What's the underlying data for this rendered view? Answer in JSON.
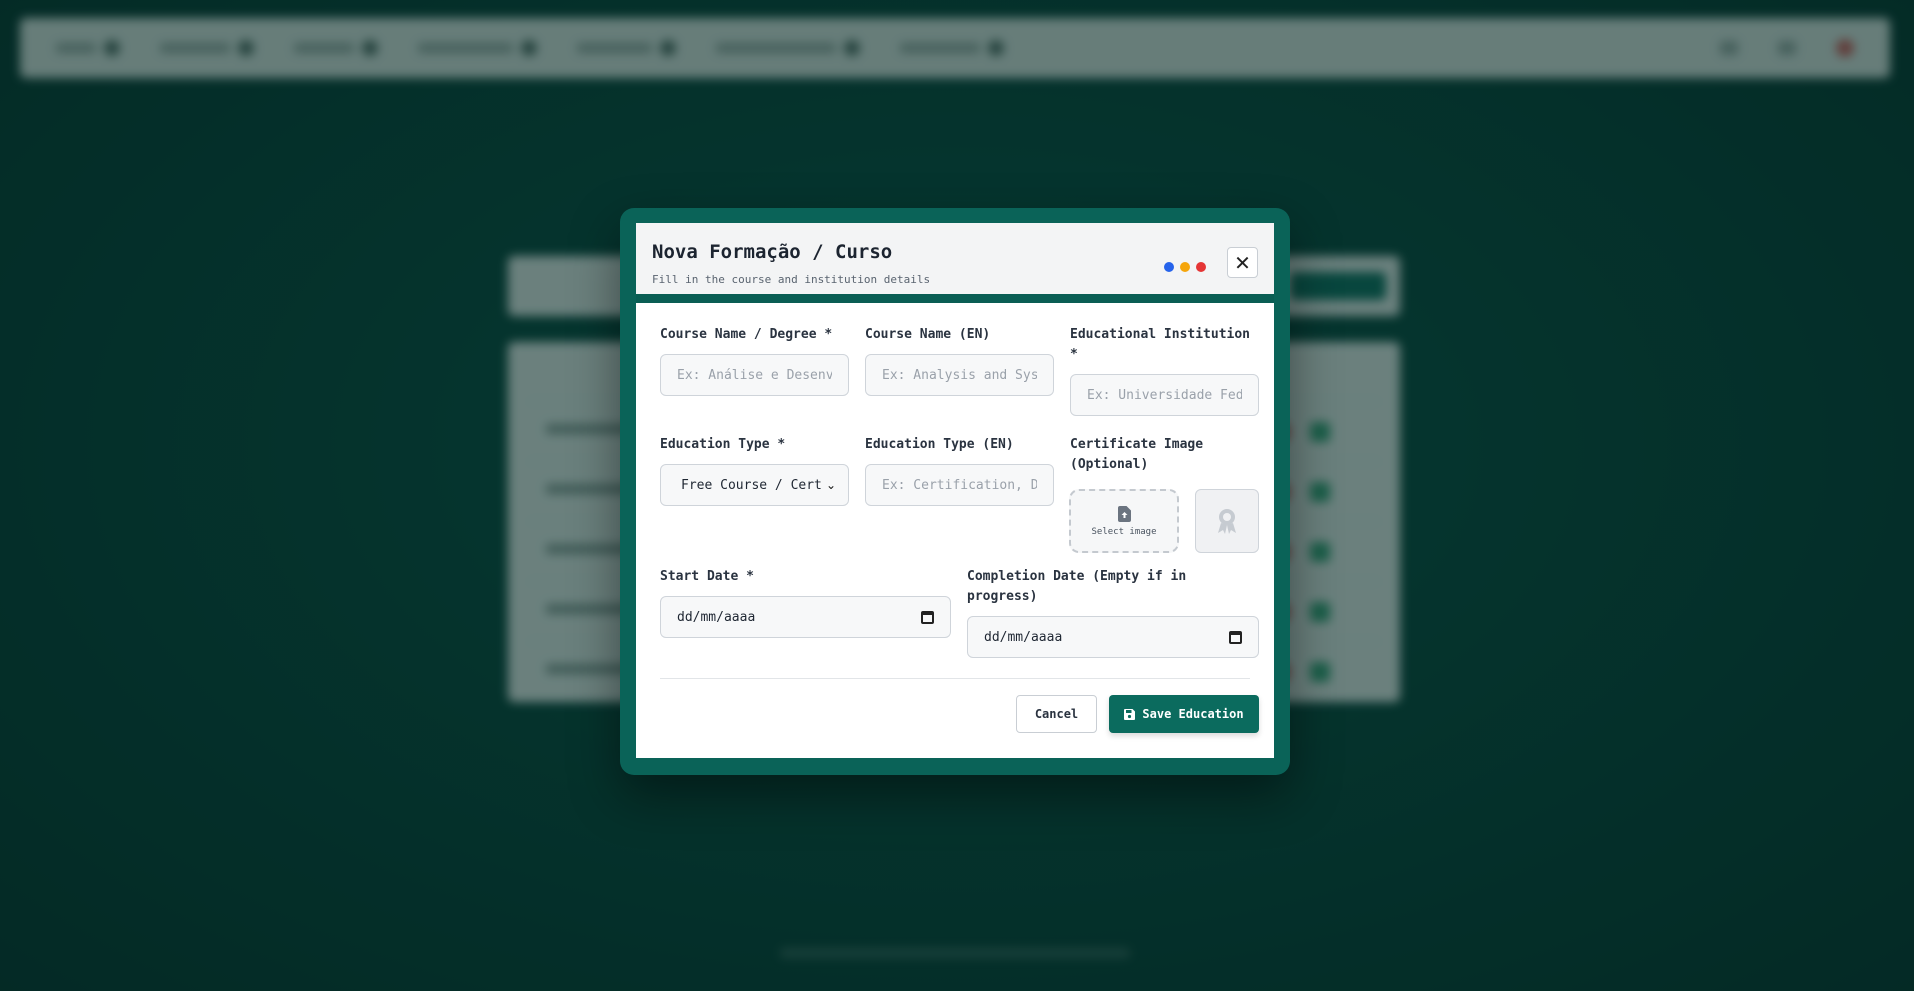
{
  "colors": {
    "accent": "#0b6b5e",
    "dot_blue": "#2563eb",
    "dot_yellow": "#f5a50b",
    "dot_red": "#e53535"
  },
  "modal": {
    "title": "Nova Formação / Curso",
    "subtitle": "Fill in the course and institution details",
    "close_icon": "close-icon"
  },
  "form": {
    "course_name": {
      "label": "Course Name / Degree *",
      "placeholder": "Ex: Análise e Desenvolvimento de Sistemas",
      "value": ""
    },
    "course_name_en": {
      "label": "Course Name (EN)",
      "placeholder": "Ex: Analysis and Systems Development",
      "value": ""
    },
    "institution": {
      "label": "Educational Institution *",
      "placeholder": "Ex: Universidade Federal",
      "value": ""
    },
    "education_type": {
      "label": "Education Type *",
      "selected": "Free Course / Certification"
    },
    "education_type_en": {
      "label": "Education Type (EN)",
      "placeholder": "Ex: Certification, Degree",
      "value": ""
    },
    "certificate_image": {
      "label": "Certificate Image (Optional)",
      "upload_label": "Select image",
      "upload_icon": "file-upload-icon",
      "preview_icon": "award-icon"
    },
    "start_date": {
      "label": "Start Date *",
      "placeholder": "dd/mm/aaaa"
    },
    "completion_date": {
      "label": "Completion Date (Empty if in progress)",
      "placeholder": "dd/mm/aaaa"
    }
  },
  "actions": {
    "cancel_label": "Cancel",
    "save_label": "Save Education",
    "save_icon": "save-icon"
  }
}
